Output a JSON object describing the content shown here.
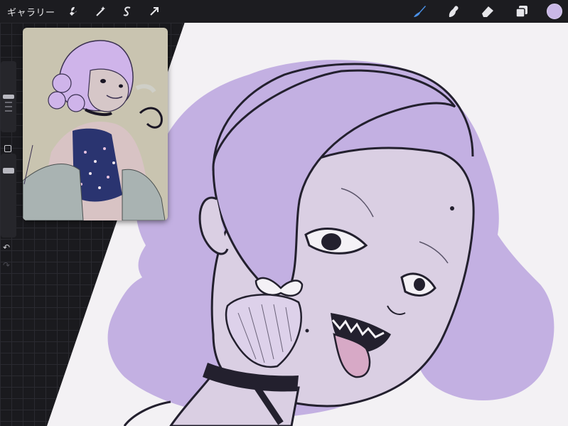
{
  "toolbar": {
    "gallery_label": "ギャラリー",
    "left_icons": [
      "wrench-icon",
      "magic-wand-icon",
      "selection-icon",
      "transform-arrow-icon"
    ],
    "right_icons": [
      "brush-icon",
      "smudge-icon",
      "eraser-icon",
      "layers-icon"
    ],
    "current_color": "#c9b7e6"
  },
  "sidebar": {
    "brush_size_level": 0.5,
    "opacity_level": 0.75
  },
  "reference": {
    "visible": true
  }
}
